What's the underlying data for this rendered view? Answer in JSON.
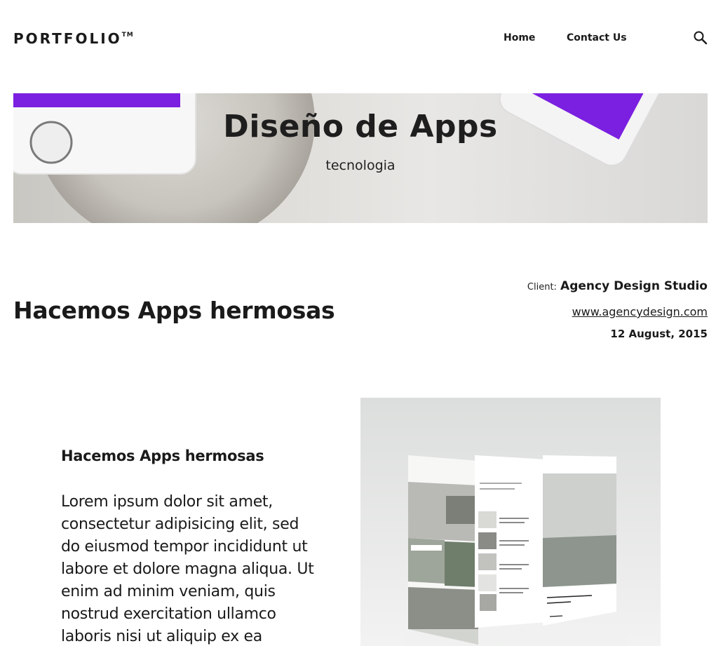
{
  "header": {
    "logo_text": "PORTFOLIO",
    "logo_mark": "TM",
    "nav": [
      {
        "label": "Home"
      },
      {
        "label": "Contact Us"
      }
    ],
    "search_icon": "search-icon"
  },
  "hero": {
    "title": "Diseño de Apps",
    "subtitle": "tecnologia"
  },
  "project": {
    "heading": "Hacemos Apps hermosas",
    "client_label": "Client:",
    "client_name": "Agency Design Studio",
    "url": "www.agencydesign.com",
    "date": "12 August, 2015"
  },
  "content": {
    "title": "Hacemos Apps hermosas",
    "body": "Lorem ipsum dolor sit amet, consectetur adipisicing elit, sed do eiusmod tempor incididunt ut labore et dolore magna aliqua. Ut enim ad minim veniam, quis nostrud exercitation ullamco laboris nisi ut aliquip ex ea"
  },
  "colors": {
    "text": "#1a1a1a",
    "background": "#ffffff",
    "accent_purple": "#7b1fe0"
  }
}
